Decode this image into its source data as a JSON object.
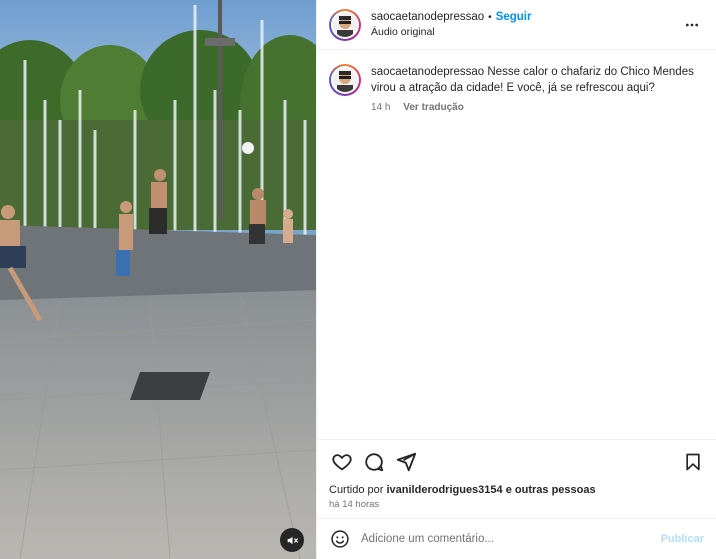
{
  "post": {
    "username": "saocaetanodepressao",
    "separator": "•",
    "follow_label": "Seguir",
    "audio_label": "Áudio original",
    "more_icon": "more-horizontal-icon"
  },
  "caption": {
    "username": "saocaetanodepressao",
    "text": "Nesse calor o chafariz do Chico Mendes virou a atração da cidade! E você, já se refrescou aqui?",
    "time": "14 h",
    "translate_label": "Ver tradução"
  },
  "actions": {
    "like_icon": "heart-icon",
    "comment_icon": "comment-icon",
    "share_icon": "send-icon",
    "save_icon": "bookmark-icon"
  },
  "likes": {
    "prefix": "Curtido por",
    "user": "ivanilderodrigues3154",
    "suffix": "e outras pessoas"
  },
  "timestamp": "há 14 horas",
  "comment_box": {
    "placeholder": "Adicione um comentário...",
    "post_label": "Publicar",
    "emoji_icon": "smiley-icon"
  },
  "media": {
    "mute_icon": "speaker-muted-icon"
  },
  "colors": {
    "accent": "#0095f6",
    "post_disabled": "#b2dffc",
    "secondary_text": "#737373"
  }
}
